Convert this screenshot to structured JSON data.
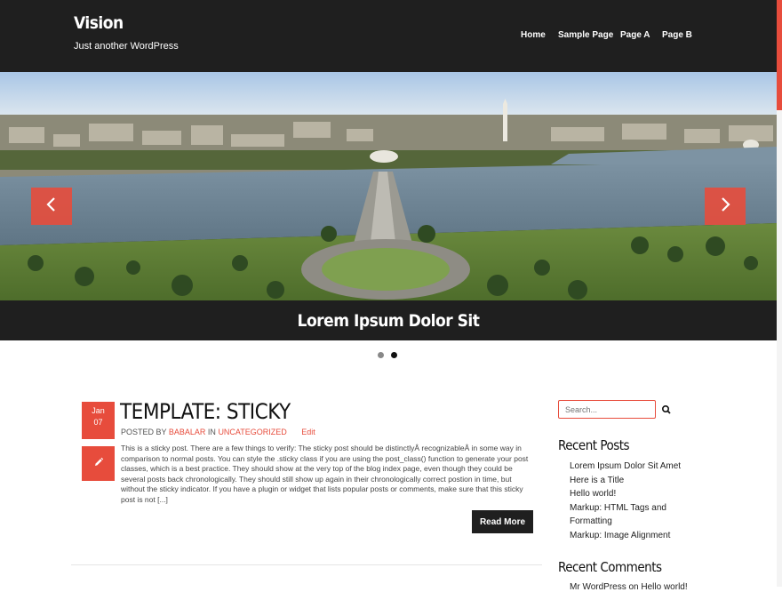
{
  "site": {
    "title": "Vision",
    "tagline": "Just another WordPress"
  },
  "nav": {
    "items": [
      "Home",
      "Sample Page",
      "Page A",
      "Page B"
    ]
  },
  "slider": {
    "caption": "Lorem Ipsum Dolor Sit",
    "active_index": 2,
    "slide_count": 2
  },
  "post": {
    "month": "Jan",
    "day": "07",
    "title": "TEMPLATE: STICKY",
    "posted_by_label": "POSTED BY",
    "author": "BABALAR",
    "in_label": "IN",
    "category": "UNCATEGORIZED",
    "edit_label": "Edit",
    "excerpt": "This is a sticky post. There are a few things to verify: The sticky post should be distinctlyÂ recognizableÂ in some way in comparison to normal posts. You can style the .sticky class if you are using the post_class() function to generate your post classes, which is a best practice. They should show at the very top of the blog index page, even though they could be several posts back chronologically. They should still show up again in their chronologically correct postion in time, but without the sticky indicator. If you have a plugin or widget that lists popular posts or comments, make sure that this sticky post is not [...]",
    "read_more_label": "Read More"
  },
  "sidebar": {
    "search_placeholder": "Search...",
    "recent_posts_title": "Recent Posts",
    "recent_posts": [
      "Lorem Ipsum Dolor Sit Amet",
      "Here is a Title",
      "Hello world!",
      "Markup: HTML Tags and Formatting",
      "Markup: Image Alignment"
    ],
    "recent_comments_title": "Recent Comments",
    "recent_comment_partial": "Mr WordPress on Hello world!"
  },
  "colors": {
    "accent": "#e74c3c",
    "dark": "#1f1f1f"
  },
  "icons": {
    "prev": "chevron-left-icon",
    "next": "chevron-right-icon",
    "format": "pencil-icon",
    "search": "search-icon"
  }
}
